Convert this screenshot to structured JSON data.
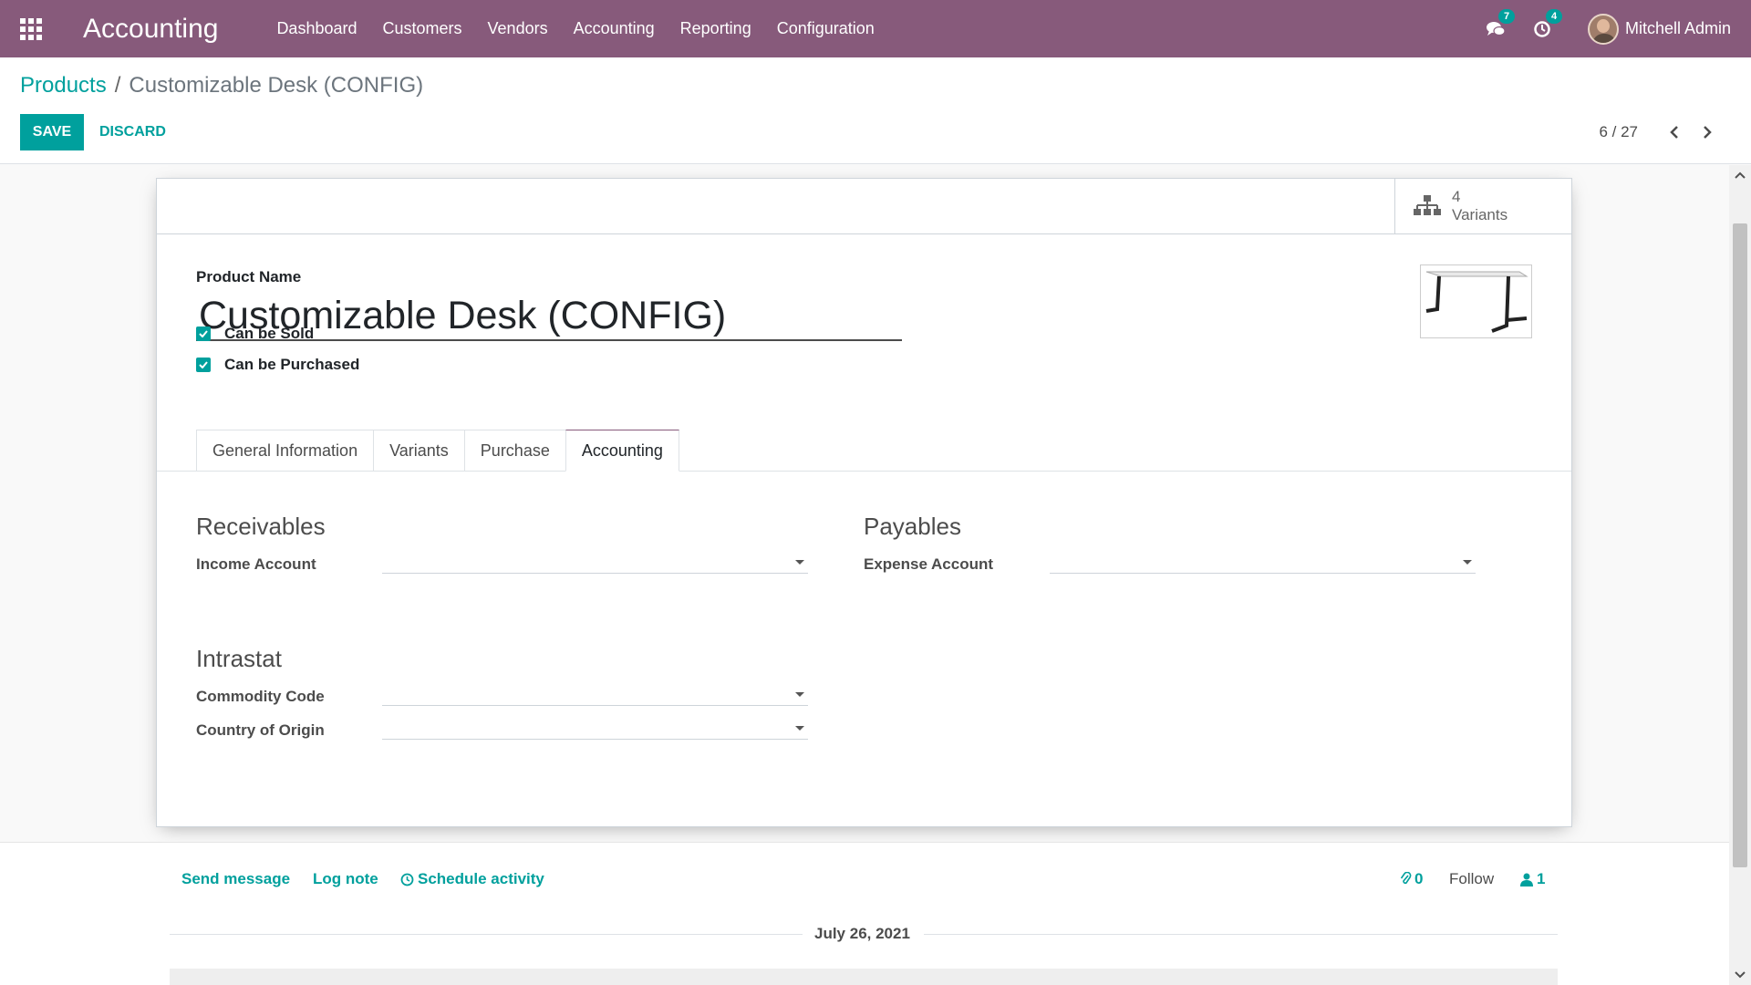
{
  "navbar": {
    "app_name": "Accounting",
    "menu": [
      "Dashboard",
      "Customers",
      "Vendors",
      "Accounting",
      "Reporting",
      "Configuration"
    ],
    "messages_count": "7",
    "activities_count": "4",
    "user_name": "Mitchell Admin"
  },
  "breadcrumb": {
    "parent": "Products",
    "separator": "/",
    "current": "Customizable Desk (CONFIG)"
  },
  "actions": {
    "save_label": "SAVE",
    "discard_label": "DISCARD"
  },
  "pager": {
    "value": "6 / 27"
  },
  "stat_buttons": {
    "variants_count": "4",
    "variants_label": "Variants"
  },
  "form": {
    "name_label": "Product Name",
    "name_value": "Customizable Desk (CONFIG)",
    "can_be_sold_label": "Can be Sold",
    "can_be_purchased_label": "Can be Purchased",
    "tabs": [
      "General Information",
      "Variants",
      "Purchase",
      "Accounting"
    ],
    "active_tab": "Accounting"
  },
  "accounting_tab": {
    "receivables_title": "Receivables",
    "income_account_label": "Income Account",
    "payables_title": "Payables",
    "expense_account_label": "Expense Account",
    "intrastat_title": "Intrastat",
    "commodity_code_label": "Commodity Code",
    "country_origin_label": "Country of Origin"
  },
  "chatter": {
    "send_message": "Send message",
    "log_note": "Log note",
    "schedule_activity": "Schedule activity",
    "attachments_count": "0",
    "follow_label": "Follow",
    "followers_count": "1",
    "date_separator": "July 26, 2021"
  },
  "colors": {
    "primary": "#875a7b",
    "accent": "#00a09d"
  }
}
